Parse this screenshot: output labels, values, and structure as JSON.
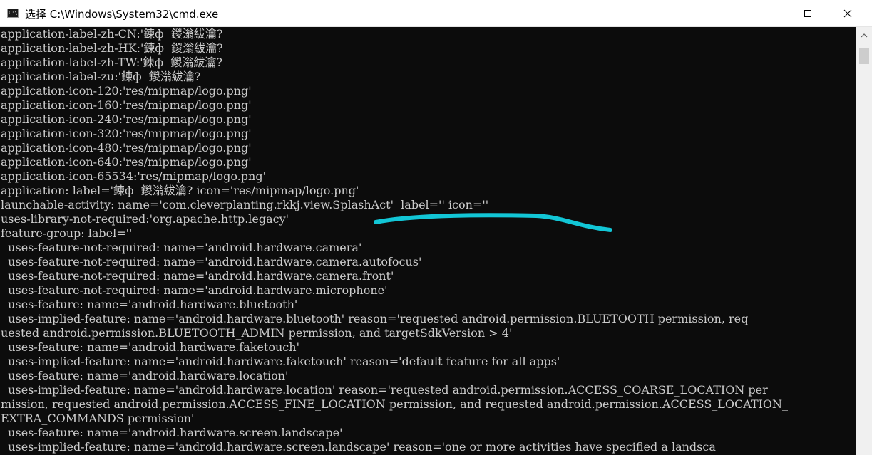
{
  "window": {
    "title": "选择 C:\\Windows\\System32\\cmd.exe",
    "icon_text": "C:\\"
  },
  "controls": {
    "minimize": "minimize-icon",
    "maximize": "maximize-icon",
    "close": "close-icon"
  },
  "console": {
    "lines": [
      "application-label-zh-CN:'鍊ф  鍐滃紱瀹?",
      "application-label-zh-HK:'鍊ф  鍐滃紱瀹?",
      "application-label-zh-TW:'鍊ф  鍐滃紱瀹?",
      "application-label-zu:'鍊ф  鍐滃紱瀹?",
      "application-icon-120:'res/mipmap/logo.png'",
      "application-icon-160:'res/mipmap/logo.png'",
      "application-icon-240:'res/mipmap/logo.png'",
      "application-icon-320:'res/mipmap/logo.png'",
      "application-icon-480:'res/mipmap/logo.png'",
      "application-icon-640:'res/mipmap/logo.png'",
      "application-icon-65534:'res/mipmap/logo.png'",
      "application: label='鍊ф  鍐滃紱瀹? icon='res/mipmap/logo.png'",
      "launchable-activity: name='com.cleverplanting.rkkj.view.SplashAct'  label='' icon=''",
      "uses-library-not-required:'org.apache.http.legacy'",
      "feature-group: label=''",
      "  uses-feature-not-required: name='android.hardware.camera'",
      "  uses-feature-not-required: name='android.hardware.camera.autofocus'",
      "  uses-feature-not-required: name='android.hardware.camera.front'",
      "  uses-feature-not-required: name='android.hardware.microphone'",
      "  uses-feature: name='android.hardware.bluetooth'",
      "  uses-implied-feature: name='android.hardware.bluetooth' reason='requested android.permission.BLUETOOTH permission, req",
      "uested android.permission.BLUETOOTH_ADMIN permission, and targetSdkVersion > 4'",
      "  uses-feature: name='android.hardware.faketouch'",
      "  uses-implied-feature: name='android.hardware.faketouch' reason='default feature for all apps'",
      "  uses-feature: name='android.hardware.location'",
      "  uses-implied-feature: name='android.hardware.location' reason='requested android.permission.ACCESS_COARSE_LOCATION per",
      "mission, requested android.permission.ACCESS_FINE_LOCATION permission, and requested android.permission.ACCESS_LOCATION_",
      "EXTRA_COMMANDS permission'",
      "  uses-feature: name='android.hardware.screen.landscape'",
      "  uses-implied-feature: name='android.hardware.screen.landscape' reason='one or more activities have specified a landsca"
    ]
  },
  "colors": {
    "console_background": "#0c0c0c",
    "console_text": "#cccccc",
    "annotation_stroke": "#12c6d6",
    "titlebar_background": "#ffffff"
  }
}
